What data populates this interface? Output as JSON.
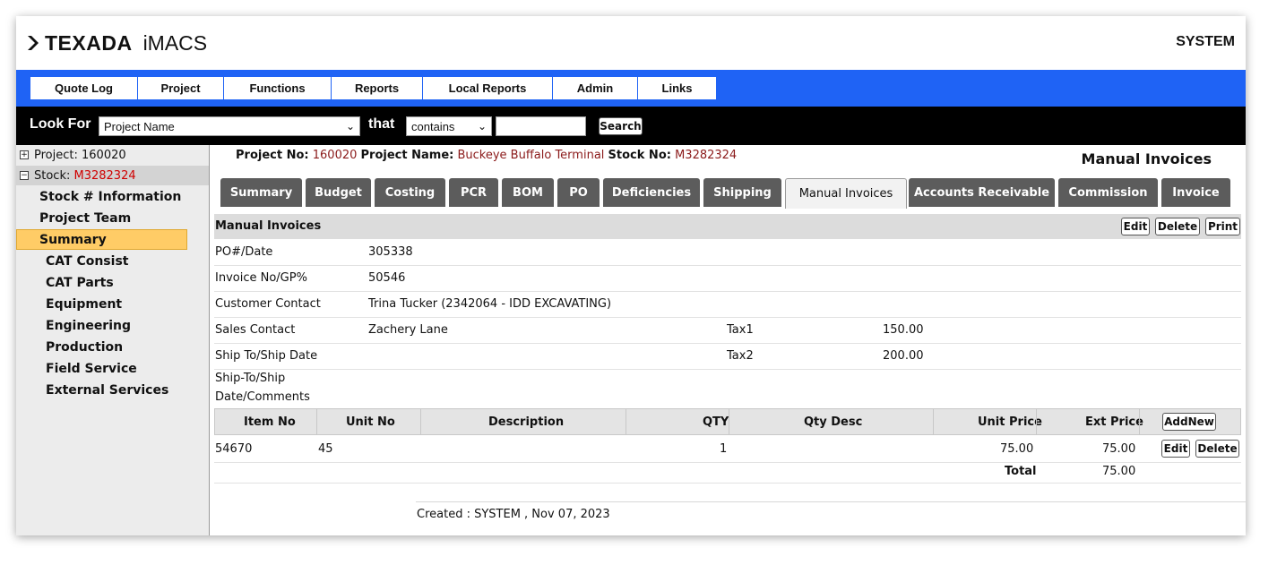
{
  "app": {
    "brand": "TEXADA",
    "product": "iMACS",
    "user": "SYSTEM"
  },
  "colors": {
    "nav": "#1f63f5",
    "active_side": "#ffcc66",
    "tab": "#5c5c5c",
    "red": "#d00000"
  },
  "nav": [
    "Quote Log",
    "Project",
    "Functions",
    "Reports",
    "Local Reports",
    "Admin",
    "Links"
  ],
  "lookfor": {
    "label": "Look For",
    "field": "Project Name",
    "that": "that",
    "operator": "contains",
    "value": "",
    "search": "Search"
  },
  "tree": {
    "project_label": "Project:",
    "project_no": "160020",
    "stock_label": "Stock:",
    "stock_no": "M3282324"
  },
  "sidebar": {
    "top": [
      "Stock # Information",
      "Project Team",
      "Summary"
    ],
    "sub": [
      "CAT Consist",
      "CAT Parts",
      "Equipment",
      "Engineering",
      "Production",
      "Field Service",
      "External Services"
    ]
  },
  "info": {
    "project_no_label": "Project No:",
    "project_no": "160020",
    "project_name_label": "Project Name:",
    "project_name": "Buckeye Buffalo Terminal",
    "stock_no_label": "Stock No:",
    "stock_no": "M3282324"
  },
  "page_title": "Manual Invoices",
  "tabs": [
    "Summary",
    "Budget",
    "Costing",
    "PCR",
    "BOM",
    "PO",
    "Deficiencies",
    "Shipping",
    "Manual Invoices",
    "Accounts Receivable",
    "Commission",
    "Invoice"
  ],
  "section": {
    "title": "Manual Invoices",
    "edit": "Edit",
    "delete": "Delete",
    "print": "Print"
  },
  "fields": {
    "po_label": "PO#/Date",
    "po": "305338",
    "inv_label": "Invoice No/GP%",
    "inv": "50546",
    "cust_label": "Customer Contact",
    "cust": "Trina Tucker (2342064 - IDD EXCAVATING)",
    "sales_label": "Sales Contact",
    "sales": "Zachery Lane",
    "tax1_label": "Tax1",
    "tax1": "150.00",
    "ship_label": "Ship To/Ship Date",
    "tax2_label": "Tax2",
    "tax2": "200.00",
    "comments_label_1": "Ship-To/Ship",
    "comments_label_2": "Date/Comments"
  },
  "grid": {
    "headers": {
      "item": "Item No",
      "unit": "Unit No",
      "desc": "Description",
      "qty": "QTY",
      "qtydesc": "Qty Desc",
      "price": "Unit Price",
      "ext": "Ext Price",
      "addnew": "AddNew"
    },
    "rows": [
      {
        "item": "54670",
        "unit": "45",
        "desc": "",
        "qty": "1",
        "qtydesc": "",
        "price": "75.00",
        "ext": "75.00",
        "edit": "Edit",
        "delete": "Delete"
      }
    ],
    "total_label": "Total",
    "total": "75.00"
  },
  "created": "Created : SYSTEM , Nov 07, 2023"
}
